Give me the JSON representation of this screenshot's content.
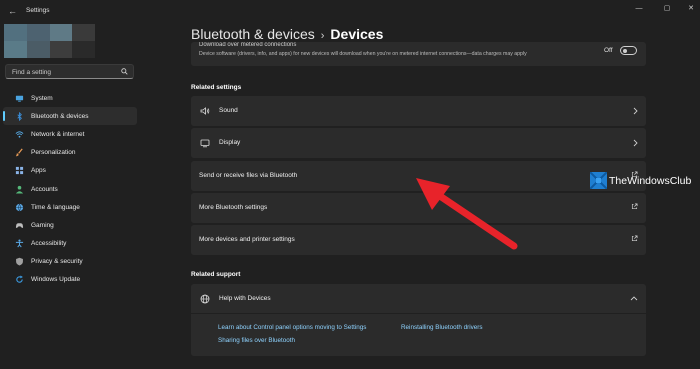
{
  "window": {
    "app_title": "Settings",
    "controls": {
      "minimize": "—",
      "maximize": "▢",
      "close": "✕"
    }
  },
  "sidebar": {
    "search_placeholder": "Find a setting",
    "items": [
      {
        "label": "System",
        "icon": "monitor-icon",
        "color": "#4aa3df"
      },
      {
        "label": "Bluetooth & devices",
        "icon": "bluetooth-icon",
        "color": "#3b8ed8",
        "active": true
      },
      {
        "label": "Network & internet",
        "icon": "wifi-icon",
        "color": "#5bb2f0"
      },
      {
        "label": "Personalization",
        "icon": "brush-icon",
        "color": "#e79a56"
      },
      {
        "label": "Apps",
        "icon": "apps-icon",
        "color": "#8ab4e8"
      },
      {
        "label": "Accounts",
        "icon": "person-icon",
        "color": "#55b87a"
      },
      {
        "label": "Time & language",
        "icon": "globe-icon",
        "color": "#5ba8e6"
      },
      {
        "label": "Gaming",
        "icon": "controller-icon",
        "color": "#bdbdbd"
      },
      {
        "label": "Accessibility",
        "icon": "accessibility-icon",
        "color": "#5aa9e6"
      },
      {
        "label": "Privacy & security",
        "icon": "shield-icon",
        "color": "#a0a0a0"
      },
      {
        "label": "Windows Update",
        "icon": "update-icon",
        "color": "#3b9ae0"
      }
    ]
  },
  "header": {
    "parent": "Bluetooth & devices",
    "separator": "›",
    "current": "Devices"
  },
  "metered": {
    "title": "Download over metered connections",
    "description": "Device software (drivers, info, and apps) for new devices will download when you're on metered internet connections—data charges may apply",
    "toggle_state": "Off"
  },
  "related_settings": {
    "heading": "Related settings",
    "rows": [
      {
        "label": "Sound",
        "icon": "speaker-icon",
        "action": "chevron"
      },
      {
        "label": "Display",
        "icon": "display-icon",
        "action": "chevron"
      },
      {
        "label": "Send or receive files via Bluetooth",
        "action": "external"
      },
      {
        "label": "More Bluetooth settings",
        "action": "external"
      },
      {
        "label": "More devices and printer settings",
        "action": "external"
      }
    ]
  },
  "related_support": {
    "heading": "Related support",
    "help_title": "Help with Devices",
    "links": [
      "Learn about Control panel options moving to Settings",
      "Reinstalling Bluetooth drivers",
      "Sharing files over Bluetooth"
    ]
  },
  "watermark": {
    "text": "TheWindowsClub"
  },
  "colors": {
    "background": "#202020",
    "card": "#2b2b2b",
    "accent": "#60cdff",
    "link": "#8fd3ff",
    "annotation_arrow": "#e8232a"
  }
}
